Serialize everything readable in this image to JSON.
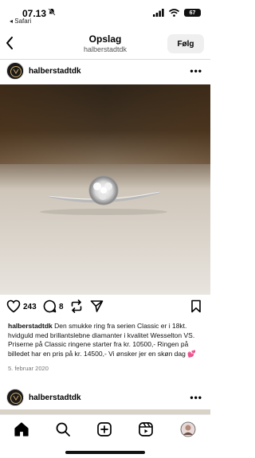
{
  "status": {
    "time": "07.13",
    "back_app": "◂ Safari",
    "battery": "67"
  },
  "header": {
    "title": "Opslag",
    "subtitle": "halberstadtdk",
    "follow_label": "Følg"
  },
  "post": {
    "username": "halberstadtdk",
    "more_label": "•••",
    "likes": "243",
    "comments": "8",
    "caption_user": "halberstadtdk",
    "caption_text": " Den smukke ring fra serien Classic er i 18kt. hvidguld med brillantslebne diamanter i kvalitet Wesselton VS. Priserne på Classic ringene starter fra kr. 10500,- Ringen på billedet har en pris på kr. 14500,- Vi ønsker jer en skøn dag 💕",
    "date": "5. februar 2020"
  },
  "next_post": {
    "username": "halberstadtdk",
    "more_label": "•••"
  },
  "icons": {
    "status": [
      "bell-slash-icon",
      "signal-icon",
      "wifi-icon",
      "battery-icon"
    ],
    "actions": [
      "heart-icon",
      "comment-icon",
      "repost-icon",
      "share-icon",
      "bookmark-icon"
    ],
    "tabs": [
      "home-icon",
      "search-icon",
      "create-icon",
      "reels-icon",
      "profile-avatar"
    ]
  },
  "colors": {
    "follow_bg": "#efefef",
    "divider": "#dbdbdb",
    "date_text": "#777777"
  }
}
